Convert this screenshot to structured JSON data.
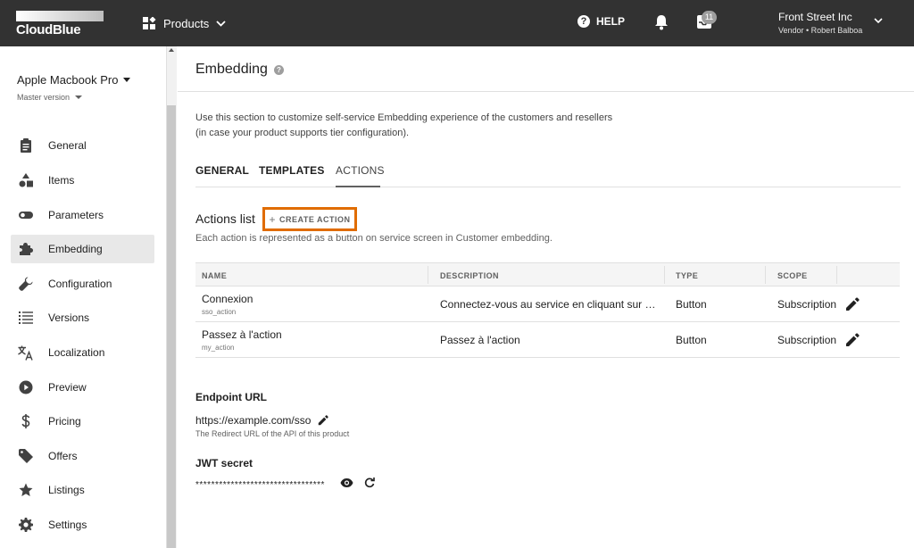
{
  "topbar": {
    "logo_text": "CloudBlue",
    "products_label": "Products",
    "help_label": "HELP",
    "help_glyph": "?",
    "inbox_count": "11",
    "account_name": "Front Street Inc",
    "account_role": "Vendor • Robert Balboa"
  },
  "sidebar": {
    "product_name": "Apple Macbook Pro",
    "version": "Master version",
    "items": [
      {
        "label": "General",
        "icon": "clipboard-icon"
      },
      {
        "label": "Items",
        "icon": "shapes-icon"
      },
      {
        "label": "Parameters",
        "icon": "toggle-icon"
      },
      {
        "label": "Embedding",
        "icon": "puzzle-icon",
        "active": true
      },
      {
        "label": "Configuration",
        "icon": "wrench-icon"
      },
      {
        "label": "Versions",
        "icon": "list-icon"
      },
      {
        "label": "Localization",
        "icon": "translate-icon"
      },
      {
        "label": "Preview",
        "icon": "play-icon"
      },
      {
        "label": "Pricing",
        "icon": "dollar-icon"
      },
      {
        "label": "Offers",
        "icon": "tag-icon"
      },
      {
        "label": "Listings",
        "icon": "star-icon"
      },
      {
        "label": "Settings",
        "icon": "gear-icon"
      }
    ]
  },
  "main": {
    "title": "Embedding",
    "help_glyph": "?",
    "description_line1": "Use this section to customize self-service Embedding experience of the customers and resellers",
    "description_line2": "(in case your product supports tier configuration).",
    "tabs": [
      {
        "label": "GENERAL"
      },
      {
        "label": "TEMPLATES"
      },
      {
        "label": "ACTIONS",
        "active": true
      }
    ],
    "actions_title": "Actions list",
    "create_action_label": "CREATE ACTION",
    "create_action_glyph": "+",
    "actions_subtitle": "Each action is represented as a button on service screen in Customer embedding.",
    "table": {
      "headers": [
        "NAME",
        "DESCRIPTION",
        "TYPE",
        "SCOPE"
      ],
      "rows": [
        {
          "name": "Connexion",
          "id": "sso_action",
          "description": "Connectez-vous au service en cliquant sur ce b…",
          "type": "Button",
          "scope": "Subscription"
        },
        {
          "name": "Passez à l'action",
          "id": "my_action",
          "description": "Passez à l'action",
          "type": "Button",
          "scope": "Subscription"
        }
      ]
    },
    "endpoint": {
      "label": "Endpoint URL",
      "value": "https://example.com/sso",
      "hint": "The Redirect URL of the API of this product"
    },
    "jwt": {
      "label": "JWT secret",
      "value": "*********************************"
    }
  },
  "colors": {
    "topbar_bg": "#323232",
    "highlight_border": "#e06c00",
    "active_nav_bg": "#e8e8e8"
  }
}
